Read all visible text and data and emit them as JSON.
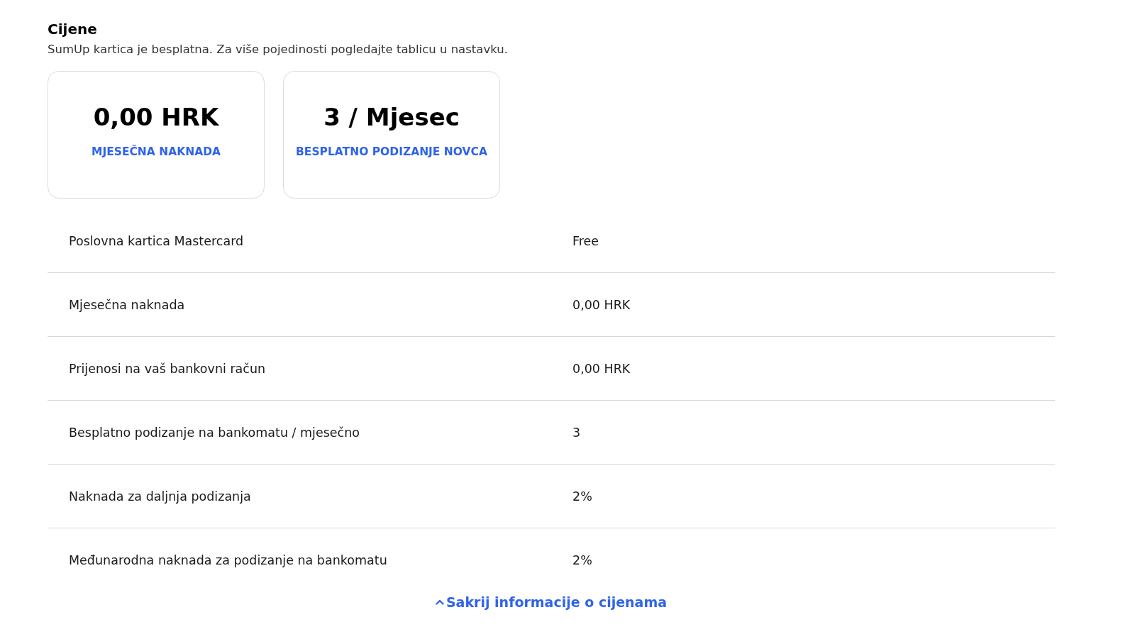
{
  "heading": "Cijene",
  "intro": "SumUp kartica je besplatna. Za više pojedinosti pogledajte tablicu u nastavku.",
  "cards": [
    {
      "value": "0,00 HRK",
      "label": "MJESEČNA NAKNADA"
    },
    {
      "value": "3 / Mjesec",
      "label": "BESPLATNO PODIZANJE NOVCA"
    }
  ],
  "rows": [
    {
      "name": "Poslovna kartica Mastercard",
      "value": "Free"
    },
    {
      "name": "Mjesečna naknada",
      "value": "0,00 HRK"
    },
    {
      "name": "Prijenosi na vaš bankovni račun",
      "value": "0,00 HRK"
    },
    {
      "name": "Besplatno podizanje na bankomatu / mjesečno",
      "value": "3"
    },
    {
      "name": "Naknada za daljnja podizanja",
      "value": "2%"
    },
    {
      "name": "Međunarodna naknada za podizanje na bankomatu",
      "value": "2%"
    }
  ],
  "toggle_link": {
    "label": "Sakrij informacije o cijenama",
    "expanded": true
  }
}
